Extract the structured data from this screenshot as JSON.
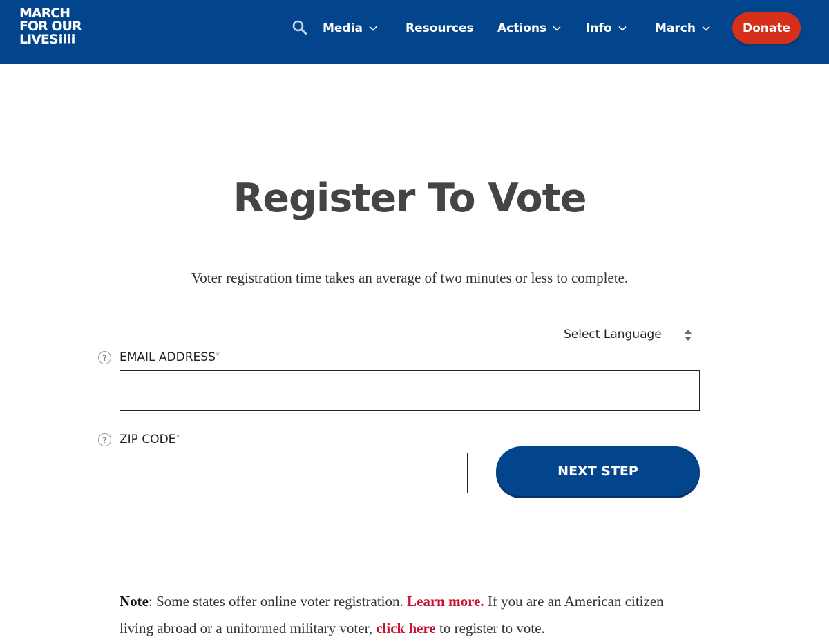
{
  "colors": {
    "header_bg": "#03458d",
    "donate_bg": "#d6301a",
    "button_bg": "#03458d",
    "link": "#c8102e"
  },
  "header": {
    "logo_lines": [
      "MARCH",
      "FOR OUR",
      "LIVES"
    ],
    "search_icon": "search-icon",
    "nav": [
      {
        "label": "Media",
        "has_dropdown": true
      },
      {
        "label": "Resources",
        "has_dropdown": false
      },
      {
        "label": "Actions",
        "has_dropdown": true
      },
      {
        "label": "Info",
        "has_dropdown": true
      },
      {
        "label": "March",
        "has_dropdown": true
      }
    ],
    "donate_label": "Donate"
  },
  "main": {
    "title": "Register To Vote",
    "subtitle": "Voter registration time takes an average of two minutes or less to complete.",
    "language_select": "Select Language",
    "form": {
      "email_label": "EMAIL ADDRESS",
      "email_value": "",
      "zip_label": "ZIP CODE",
      "zip_value": "",
      "required_mark": "*",
      "help_glyph": "?",
      "submit_label": "NEXT STEP"
    },
    "note": {
      "lead": "Note",
      "part1": ": Some states offer online voter registration. ",
      "link1": "Learn more.",
      "part2": " If you are an American citizen living abroad or a uniformed military voter, ",
      "link2": "click here",
      "part3": " to register to vote."
    }
  }
}
